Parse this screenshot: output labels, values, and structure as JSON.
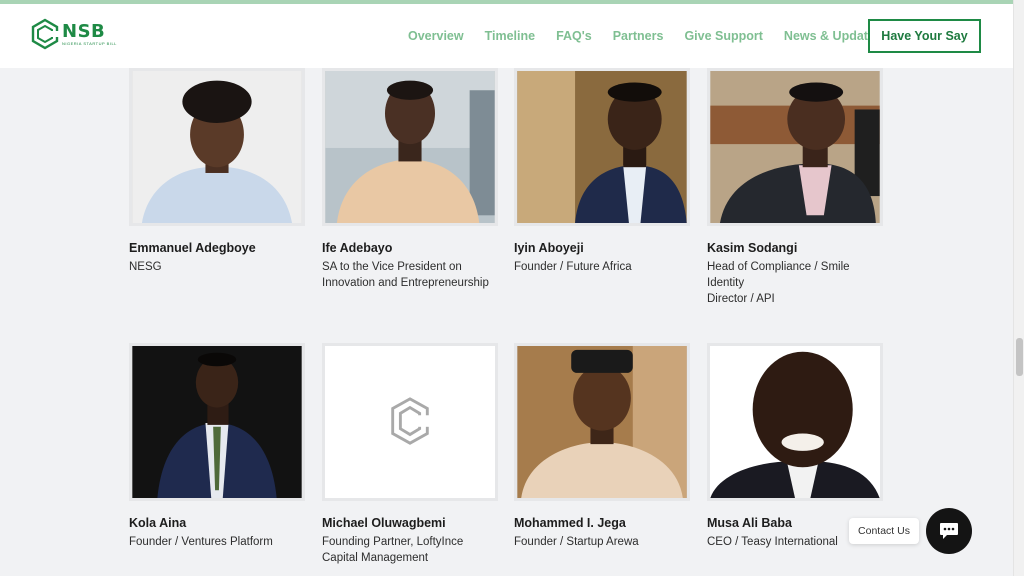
{
  "brand": {
    "name": "NSB",
    "subtitle": "Nigeria Startup Bill",
    "color": "#1e8a45"
  },
  "nav": {
    "items": [
      "Overview",
      "Timeline",
      "FAQ's",
      "Partners",
      "Give Support",
      "News & Updates"
    ],
    "cta": "Have Your Say"
  },
  "people": [
    {
      "name": "Emmanuel Adegboye",
      "role": "NESG"
    },
    {
      "name": "Ife Adebayo",
      "role": "SA to the Vice President on\nInnovation and Entrepreneurship"
    },
    {
      "name": "Iyin Aboyeji",
      "role": "Founder / Future Africa"
    },
    {
      "name": "Kasim Sodangi",
      "role": "Head of Compliance / Smile\nIdentity\nDirector / API"
    },
    {
      "name": "Kola Aina",
      "role": "Founder / Ventures Platform"
    },
    {
      "name": "Michael Oluwagbemi",
      "role": "Founding Partner, LoftyInce\nCapital Management"
    },
    {
      "name": "Mohammed I. Jega",
      "role": "Founder / Startup Arewa"
    },
    {
      "name": "Musa Ali Baba",
      "role": "CEO / Teasy International"
    }
  ],
  "contact": {
    "label": "Contact Us"
  }
}
